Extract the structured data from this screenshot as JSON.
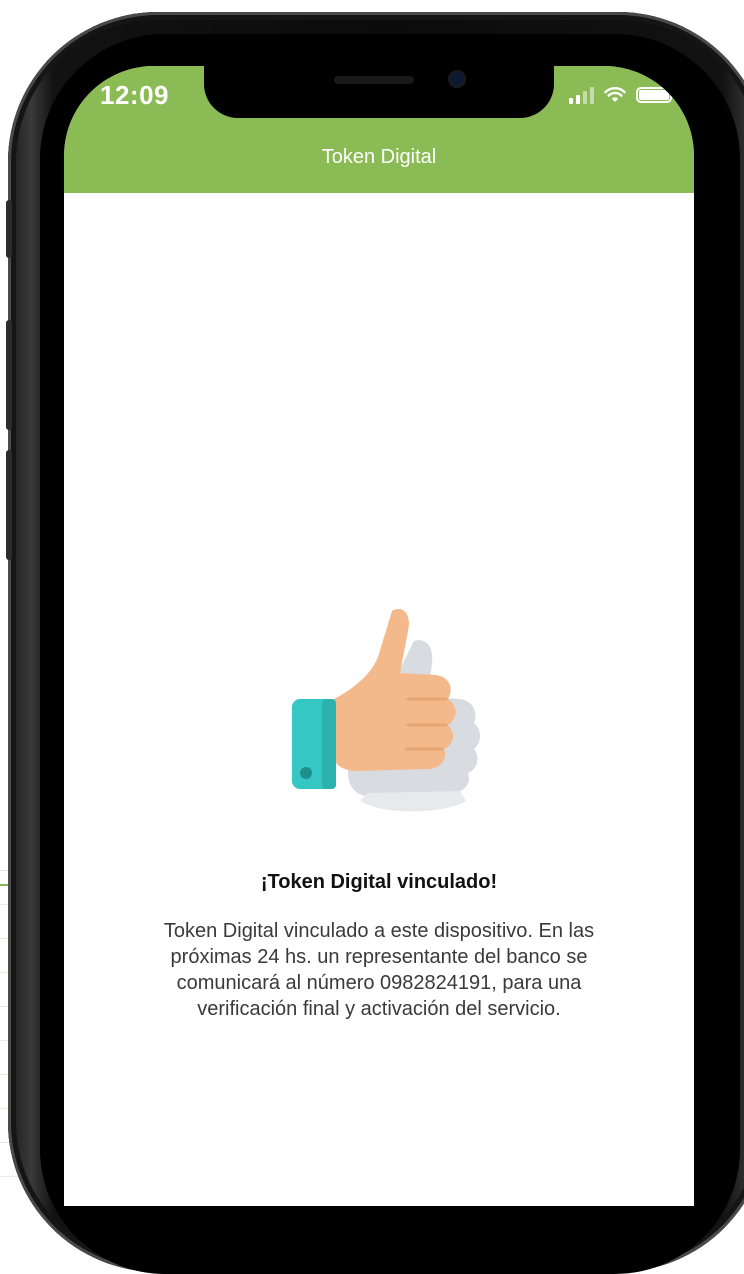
{
  "status_bar": {
    "time": "12:09"
  },
  "nav": {
    "title": "Token Digital"
  },
  "content": {
    "headline": "¡Token Digital vinculado!",
    "message": "Token Digital vinculado a este dispositivo. En las próximas 24 hs. un representante del banco se comunicará al número 0982824191, para una verificación final y activación del servicio.",
    "illustration_icon": "thumbs-up-icon"
  },
  "colors": {
    "header_green": "#8bbb55",
    "cuff_teal": "#35c7c4",
    "skin": "#f4b98a"
  }
}
